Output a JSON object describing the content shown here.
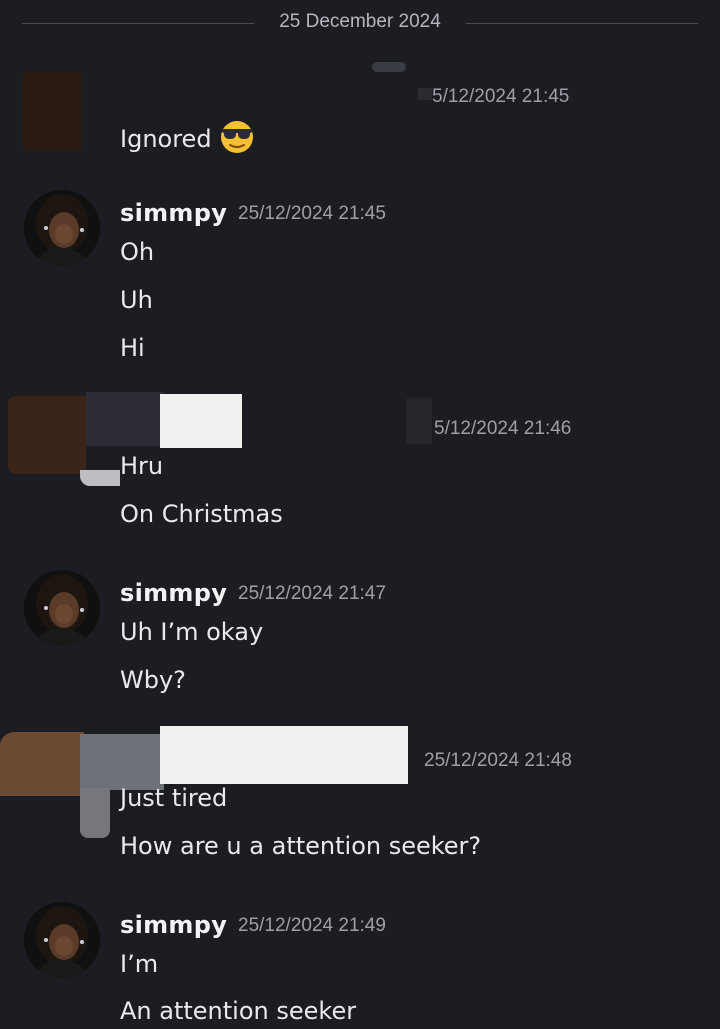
{
  "divider": {
    "date": "25 December 2024"
  },
  "messages": [
    {
      "timestamp": "5/12/2024 21:45",
      "lines": [
        "Ignored"
      ]
    },
    {
      "author": "simmpy",
      "timestamp": "25/12/2024 21:45",
      "lines": [
        "Oh",
        "Uh",
        "Hi"
      ]
    },
    {
      "timestamp": "5/12/2024 21:46",
      "lines": [
        "Hru",
        "On Christmas"
      ]
    },
    {
      "author": "simmpy",
      "timestamp": "25/12/2024 21:47",
      "lines": [
        "Uh I’m okay",
        "Wby?"
      ]
    },
    {
      "timestamp": "25/12/2024 21:48",
      "lines": [
        "Just tired",
        "How are u a attention seeker?"
      ]
    },
    {
      "author": "simmpy",
      "timestamp": "25/12/2024 21:49",
      "lines": [
        "I’m",
        "An attention seeker"
      ]
    }
  ],
  "icons": {
    "emoji_after_ignored": "sunglasses-face-emoji",
    "avatar": "simmpy-avatar"
  }
}
